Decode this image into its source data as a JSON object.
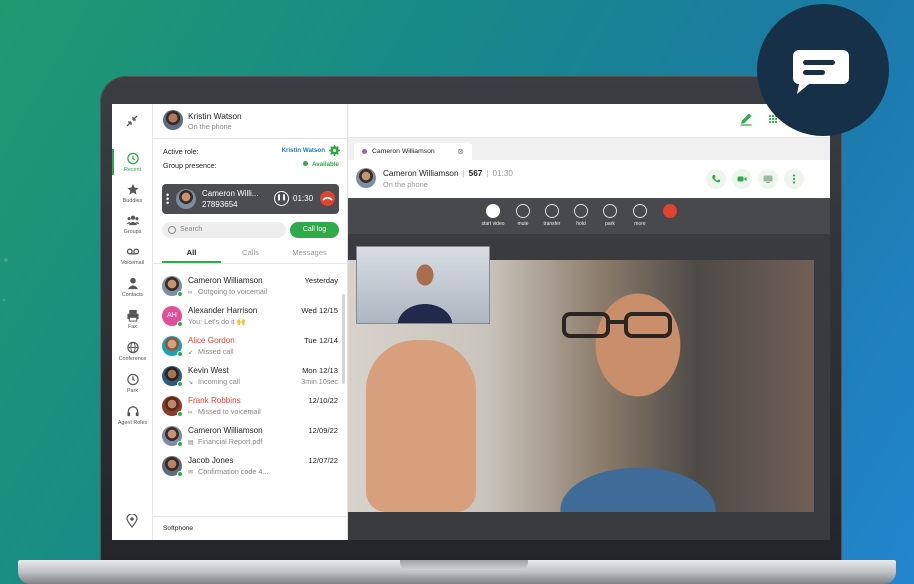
{
  "user": {
    "name": "Kristin Watson",
    "status": "On the phone"
  },
  "sidebar": {
    "items": [
      {
        "label": "Recent",
        "icon": "clock-icon"
      },
      {
        "label": "Buddies",
        "icon": "star-icon"
      },
      {
        "label": "Groups",
        "icon": "group-icon"
      },
      {
        "label": "Voicemail",
        "icon": "voicemail-icon"
      },
      {
        "label": "Contacts",
        "icon": "contact-icon"
      },
      {
        "label": "Fax",
        "icon": "fax-icon"
      },
      {
        "label": "Conference",
        "icon": "globe-icon"
      },
      {
        "label": "Park",
        "icon": "park-icon"
      },
      {
        "label": "Agent Roles",
        "icon": "headset-icon"
      }
    ]
  },
  "role": {
    "label": "Active role:",
    "value": "Kristin Watson"
  },
  "presence": {
    "label": "Group presence:",
    "value": "Available"
  },
  "active_call": {
    "name": "Cameron Willi...",
    "number": "27893654",
    "timer": "01:30"
  },
  "search": {
    "placeholder": "Search"
  },
  "call_log_button": "Call log",
  "tabs": [
    "All",
    "Calls",
    "Messages"
  ],
  "recent": [
    {
      "name": "Cameron Williamson",
      "desc": "Outgoing to voicemail",
      "date": "Yesterday",
      "extra": "",
      "missed": false
    },
    {
      "name": "Alexander Harrison",
      "desc": "You: Let's do it 🙌",
      "date": "Wed 12/15",
      "extra": "",
      "missed": false,
      "initials": "AH"
    },
    {
      "name": "Alice Gordon",
      "desc": "Missed call",
      "date": "Tue 12/14",
      "extra": "",
      "missed": true
    },
    {
      "name": "Kevin West",
      "desc": "Incoming call",
      "date": "Mon 12/13",
      "extra": "3min 10sec",
      "missed": false
    },
    {
      "name": "Frank Robbins",
      "desc": "Missed to voicemail",
      "date": "12/10/22",
      "extra": "",
      "missed": true
    },
    {
      "name": "Cameron Williamson",
      "desc": "Financial Report.pdf",
      "date": "12/09/22",
      "extra": "",
      "missed": false
    },
    {
      "name": "Jacob Jones",
      "desc": "Confirmation code 4...",
      "date": "12/07/22",
      "extra": "",
      "missed": false
    }
  ],
  "softphone": "Softphone",
  "conversation_tab": "Cameron Williamson",
  "call_header": {
    "name": "Cameron Williamson",
    "ext": "567",
    "time": "01:30",
    "status": "On the phone"
  },
  "controls": [
    "start video",
    "mute",
    "transfer",
    "hold",
    "park",
    "more"
  ],
  "colors": {
    "accent": "#2eaa4a",
    "danger": "#e0432f",
    "link": "#1b7ac6",
    "badge": "#163048"
  }
}
